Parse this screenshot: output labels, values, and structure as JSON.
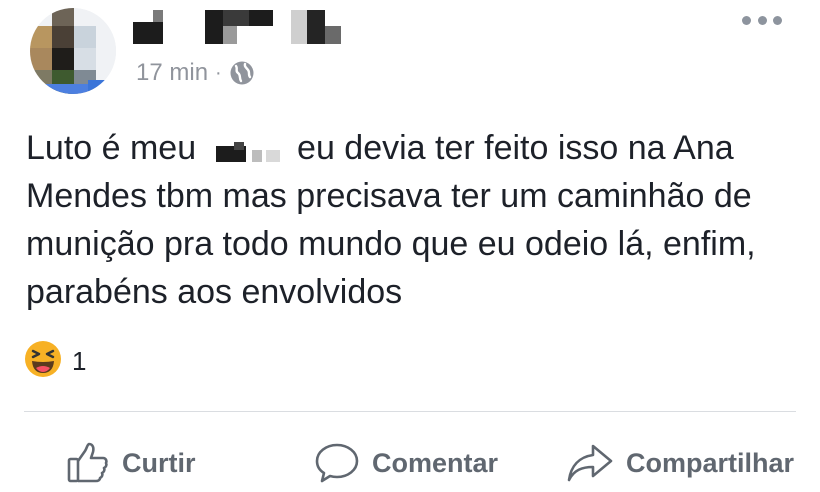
{
  "post": {
    "timestamp": "17 min",
    "separator": "·",
    "privacy_icon": "globe-icon",
    "text_before": "Luto é meu",
    "text_after": "eu devia ter feito isso na Ana Mendes tbm mas precisava ter um caminhão de munição pra todo mundo que eu odeio lá, enfim, parabéns aos envolvidos"
  },
  "reactions": {
    "icon": "haha-emoji-icon",
    "count": "1"
  },
  "actions": {
    "like_label": "Curtir",
    "comment_label": "Comentar",
    "share_label": "Compartilhar"
  },
  "colors": {
    "text": "#1d2129",
    "muted": "#90949c",
    "action": "#606770",
    "divider": "#dadde1",
    "emoji": "#f7b125"
  }
}
